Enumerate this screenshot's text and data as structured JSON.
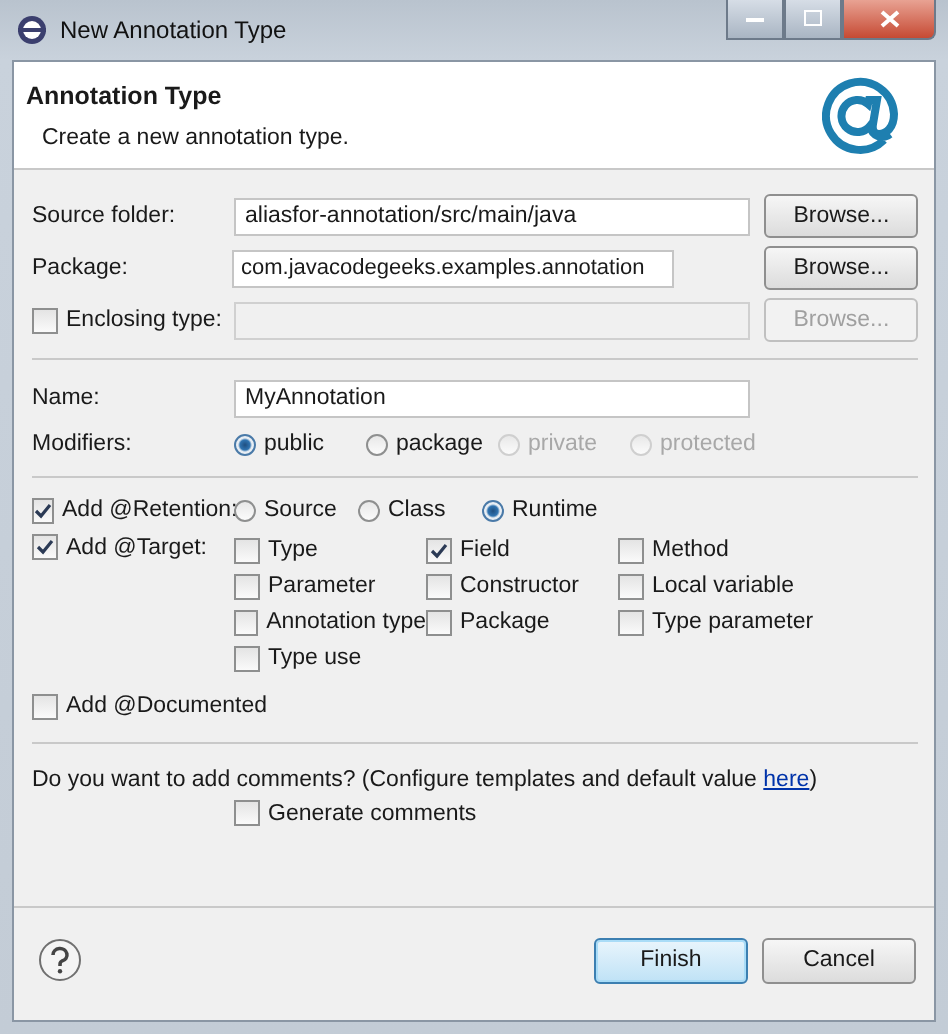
{
  "window": {
    "title": "New Annotation Type"
  },
  "header": {
    "title": "Annotation Type",
    "description": "Create a new annotation type."
  },
  "source_folder": {
    "label": "Source folder:",
    "value": "aliasfor-annotation/src/main/java",
    "button": "Browse...",
    "disabled": false
  },
  "package": {
    "label": "Package:",
    "value": "com.javacodegeeks.examples.annotation",
    "button": "Browse...",
    "disabled": false
  },
  "enclosing_type": {
    "label": "Enclosing type:",
    "checked": false,
    "button": "Browse...",
    "disabled": true
  },
  "name": {
    "label": "Name:",
    "value": "MyAnnotation"
  },
  "modifiers": {
    "label": "Modifiers:",
    "options": [
      {
        "label": "public",
        "selected": true,
        "disabled": false
      },
      {
        "label": "package",
        "selected": false,
        "disabled": false
      },
      {
        "label": "private",
        "selected": false,
        "disabled": true
      },
      {
        "label": "protected",
        "selected": false,
        "disabled": true
      }
    ]
  },
  "retention": {
    "label": "Add @Retention:",
    "checked": true,
    "options": [
      {
        "label": "Source",
        "selected": false
      },
      {
        "label": "Class",
        "selected": false
      },
      {
        "label": "Runtime",
        "selected": true
      }
    ]
  },
  "target": {
    "label": "Add @Target:",
    "checked": true,
    "options": [
      {
        "label": "Type",
        "checked": false
      },
      {
        "label": "Field",
        "checked": true
      },
      {
        "label": "Method",
        "checked": false
      },
      {
        "label": "Parameter",
        "checked": false
      },
      {
        "label": "Constructor",
        "checked": false
      },
      {
        "label": "Local variable",
        "checked": false
      },
      {
        "label": "Annotation type",
        "checked": false
      },
      {
        "label": "Package",
        "checked": false
      },
      {
        "label": "Type parameter",
        "checked": false
      },
      {
        "label": "Type use",
        "checked": false
      }
    ]
  },
  "documented": {
    "label": "Add @Documented",
    "checked": false
  },
  "comments": {
    "text_before": "Do you want to add comments? (Configure templates and default value ",
    "link": "here",
    "text_after": ")",
    "generate": {
      "label": "Generate comments",
      "checked": false
    }
  },
  "buttons": [
    {
      "label": "Finish",
      "default": true
    },
    {
      "label": "Cancel",
      "default": false
    }
  ]
}
